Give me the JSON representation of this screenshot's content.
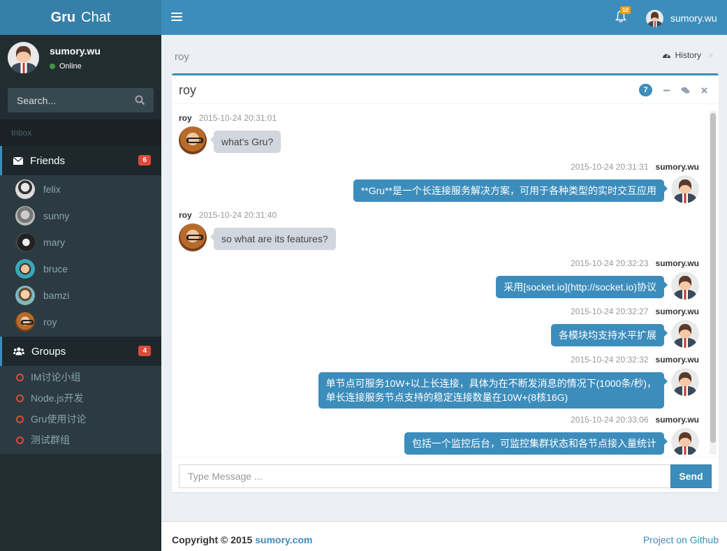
{
  "app": {
    "logo_bold": "Gru",
    "logo_light": "Chat"
  },
  "navbar": {
    "notification_count": "10",
    "user_name": "sumory.wu"
  },
  "sidebar": {
    "user": {
      "name": "sumory.wu",
      "status": "Online"
    },
    "search": {
      "placeholder": "Search..."
    },
    "section_header": "Inbox",
    "friends": {
      "label": "Friends",
      "badge": "6",
      "items": [
        {
          "name": "felix"
        },
        {
          "name": "sunny"
        },
        {
          "name": "mary"
        },
        {
          "name": "bruce"
        },
        {
          "name": "bamzi"
        },
        {
          "name": "roy"
        }
      ]
    },
    "groups": {
      "label": "Groups",
      "badge": "4",
      "items": [
        {
          "name": "IM讨论小组"
        },
        {
          "name": "Node.js开发"
        },
        {
          "name": "Gru使用讨论"
        },
        {
          "name": "测试群组"
        }
      ]
    }
  },
  "content_header": {
    "title": "roy",
    "breadcrumb": "History"
  },
  "chat": {
    "title": "roy",
    "message_count": "7",
    "messages": [
      {
        "side": "left",
        "name": "roy",
        "time": "2015-10-24 20:31:01",
        "text": "what's Gru?"
      },
      {
        "side": "right",
        "name": "sumory.wu",
        "time": "2015-10-24 20:31:31",
        "text": "**Gru**是一个长连接服务解决方案，可用于各种类型的实时交互应用"
      },
      {
        "side": "left",
        "name": "roy",
        "time": "2015-10-24 20:31:40",
        "text": "so what are its features?"
      },
      {
        "side": "right",
        "name": "sumory.wu",
        "time": "2015-10-24 20:32:23",
        "text": "采用[socket.io](http://socket.io)协议"
      },
      {
        "side": "right",
        "name": "sumory.wu",
        "time": "2015-10-24 20:32:27",
        "text": "各模块均支持水平扩展"
      },
      {
        "side": "right",
        "name": "sumory.wu",
        "time": "2015-10-24 20:32:32",
        "text": "单节点可服务10W+以上长连接，具体为在不断发消息的情况下(1000条/秒)，",
        "text2": "单长连接服务节点支持的稳定连接数量在10W+(8核16G)"
      },
      {
        "side": "right",
        "name": "sumory.wu",
        "time": "2015-10-24 20:33:06",
        "text": "包括一个监控后台，可监控集群状态和各节点接入量统计"
      }
    ],
    "input_placeholder": "Type Message ...",
    "send_label": "Send"
  },
  "footer": {
    "copyright": "Copyright © 2015",
    "site": "sumory.com",
    "github": "Project on Github"
  },
  "colors": {
    "primary": "#3c8dbc",
    "sidebar": "#222d32",
    "badge_red": "#dd4b39",
    "badge_orange": "#f39c12",
    "online": "#3c9a3c"
  }
}
